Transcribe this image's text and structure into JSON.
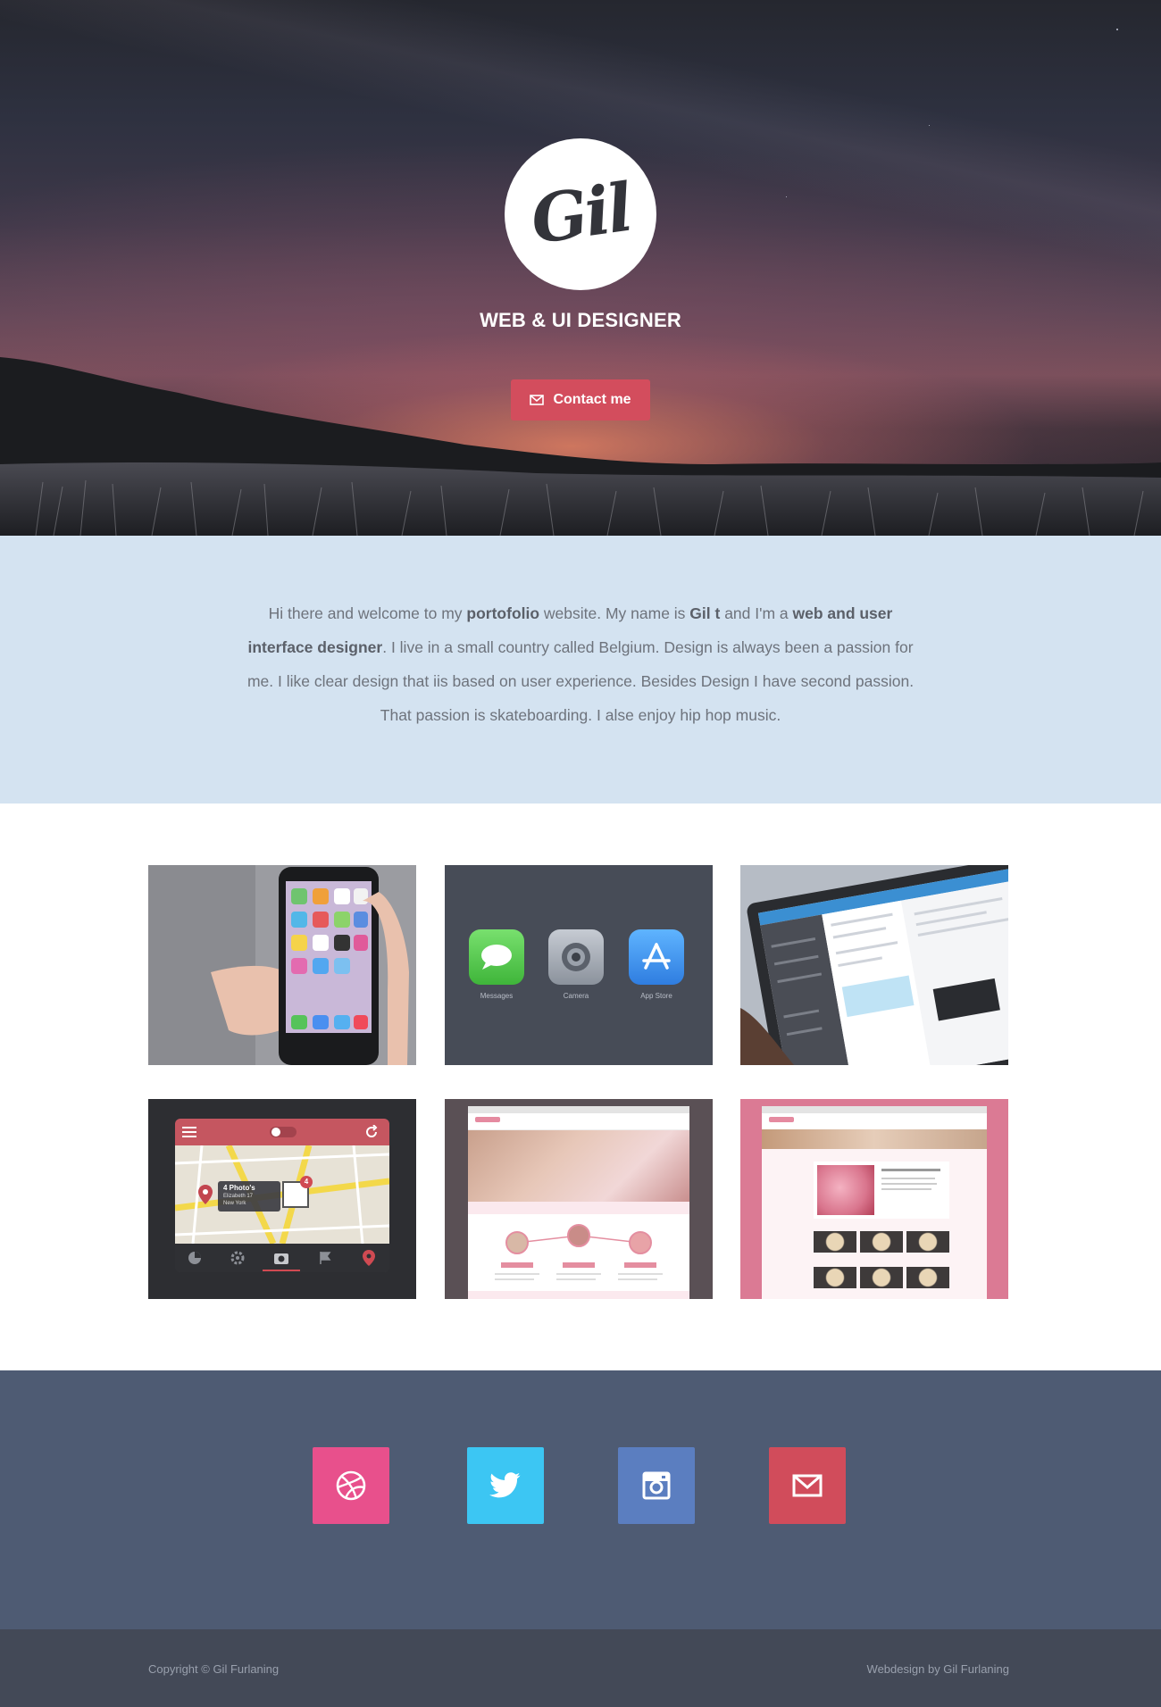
{
  "hero": {
    "logo_text": "Gil",
    "tagline": "WEB & UI DESIGNER",
    "contact_button": "Contact me",
    "contact_icon": "mail-icon"
  },
  "about": {
    "segments": [
      {
        "text": "Hi there and welcome to my ",
        "bold": false
      },
      {
        "text": "portofolio",
        "bold": true
      },
      {
        "text": " website. My name is ",
        "bold": false
      },
      {
        "text": "Gil t",
        "bold": true
      },
      {
        "text": " and I'm a ",
        "bold": false
      },
      {
        "text": "web and user interface designer",
        "bold": true
      },
      {
        "text": ". I live in a small country called Belgium. Design is always been a passion for me. I like clear design that iis based on user experience. Besides Design I have second passion. That passion is skateboarding. I alse enjoy hip hop music.",
        "bold": false
      }
    ]
  },
  "portfolio": {
    "tiles": [
      {
        "name": "iPhone in hand"
      },
      {
        "name": "iOS icons",
        "labels": [
          "Messages",
          "Camera",
          "App Store"
        ]
      },
      {
        "name": "iPad mail app"
      },
      {
        "name": "Photo map app",
        "photo_count": "4",
        "photo_label": "4 Photo's",
        "address": [
          "Elizabeth 17",
          "New York"
        ]
      },
      {
        "name": "Website design dark"
      },
      {
        "name": "Website design pink"
      }
    ]
  },
  "social": {
    "items": [
      {
        "name": "dribbble",
        "color": "#e8508c"
      },
      {
        "name": "twitter",
        "color": "#3cc6f3"
      },
      {
        "name": "instagram",
        "color": "#5b7ec0"
      },
      {
        "name": "mail",
        "color": "#d14c5b"
      }
    ]
  },
  "footer": {
    "copyright": "Copyright © Gil Furlaning",
    "credit": "Webdesign by Gil Furlaning"
  },
  "colors": {
    "accent": "#d34d5d",
    "about_bg": "#d4e3f1",
    "social_bg": "#4e5b73",
    "footer_bg": "#434957"
  }
}
